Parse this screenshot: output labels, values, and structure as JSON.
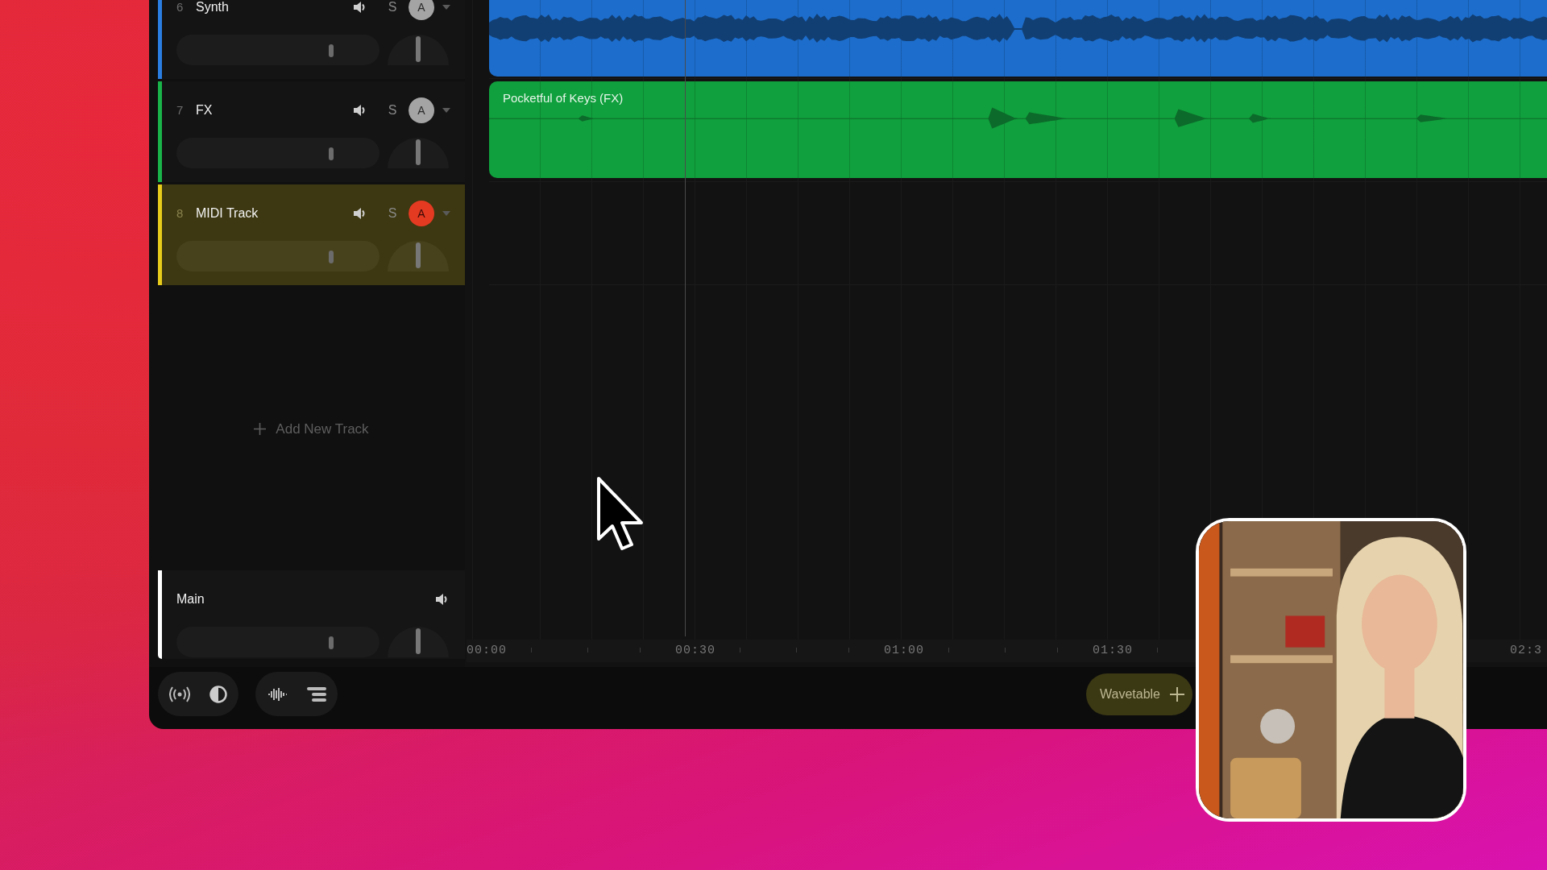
{
  "tracks": [
    {
      "number": "6",
      "name": "Synth",
      "color": "#2a7de1",
      "solo_label": "S",
      "arm_label": "A",
      "armed": false,
      "selected": false,
      "level": 0.76
    },
    {
      "number": "7",
      "name": "FX",
      "color": "#19b34a",
      "solo_label": "S",
      "arm_label": "A",
      "armed": false,
      "selected": false,
      "level": 0.76
    },
    {
      "number": "8",
      "name": "MIDI Track",
      "color": "#e8cc1c",
      "solo_label": "S",
      "arm_label": "A",
      "armed": true,
      "selected": true,
      "level": 0.76
    }
  ],
  "add_track": "Add New Track",
  "main": {
    "name": "Main",
    "level": 0.76
  },
  "clips": [
    {
      "kind": "dense",
      "color": "#1c6dcc"
    },
    {
      "kind": "sparse",
      "color": "#10a03d",
      "name": "Pocketful of Keys (FX)"
    }
  ],
  "ruler": [
    "00:00",
    "00:30",
    "01:00",
    "01:30",
    "02:3"
  ],
  "instrument_button": "Wavetable"
}
